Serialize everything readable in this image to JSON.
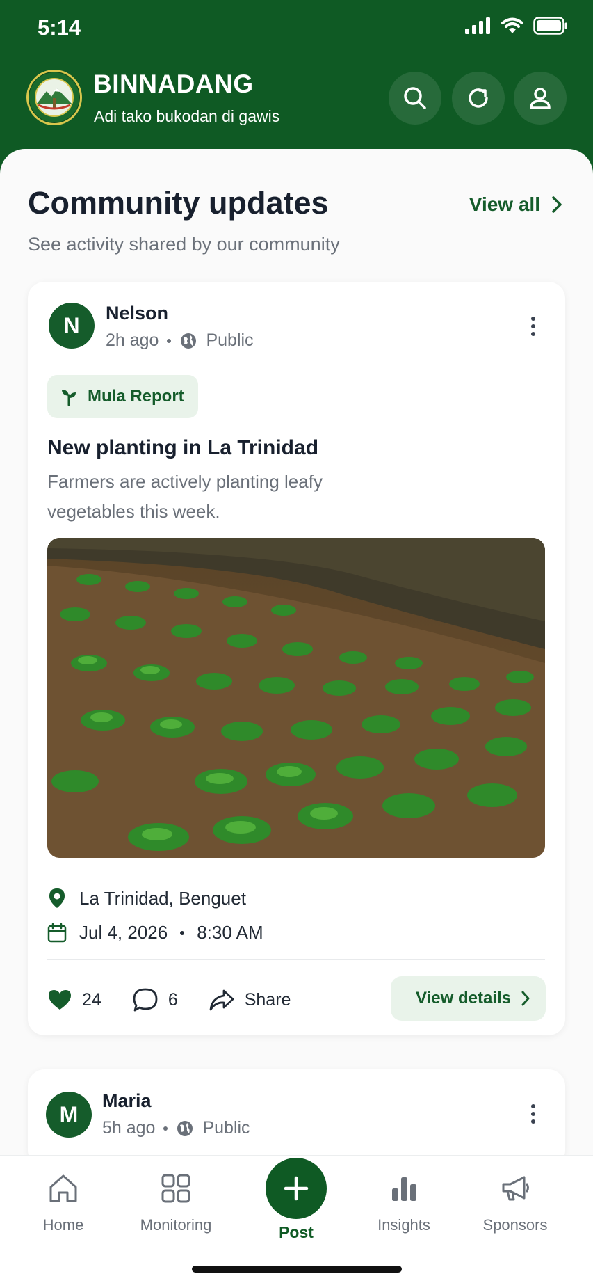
{
  "status_bar": {
    "time": "5:14"
  },
  "header": {
    "title": "BINNADANG",
    "subtitle": "Adi tako bukodan di gawis",
    "logo_icon": "municipal-seal",
    "actions": [
      "search-icon",
      "refresh-icon",
      "profile-icon"
    ]
  },
  "section": {
    "title": "Community updates",
    "subtitle": "See activity shared by our community",
    "view_all": "View all"
  },
  "posts": [
    {
      "initial": "N",
      "author": "Nelson",
      "time": "2h ago",
      "visibility": "Public",
      "tag": "Mula Report",
      "title": "New planting in La Trinidad",
      "description": "Farmers are actively planting leafy vegetables this week.",
      "location": "La Trinidad, Benguet",
      "date": "Jul 4, 2026",
      "time_of_day": "8:30 AM",
      "likes": "24",
      "comments": "6",
      "share_label": "Share",
      "details_label": "View details"
    },
    {
      "initial": "M",
      "author": "Maria",
      "time": "5h ago",
      "visibility": "Public"
    }
  ],
  "bottom_nav": {
    "items": [
      {
        "label": "Home",
        "icon": "home-icon"
      },
      {
        "label": "Monitoring",
        "icon": "grid-icon"
      },
      {
        "label": "Post",
        "icon": "plus-icon"
      },
      {
        "label": "Insights",
        "icon": "bar-chart-icon"
      },
      {
        "label": "Sponsors",
        "icon": "megaphone-icon"
      }
    ]
  },
  "colors": {
    "brand_green": "#0f5a24",
    "accent_green": "#155c2b",
    "tag_bg": "#e9f3ea"
  }
}
